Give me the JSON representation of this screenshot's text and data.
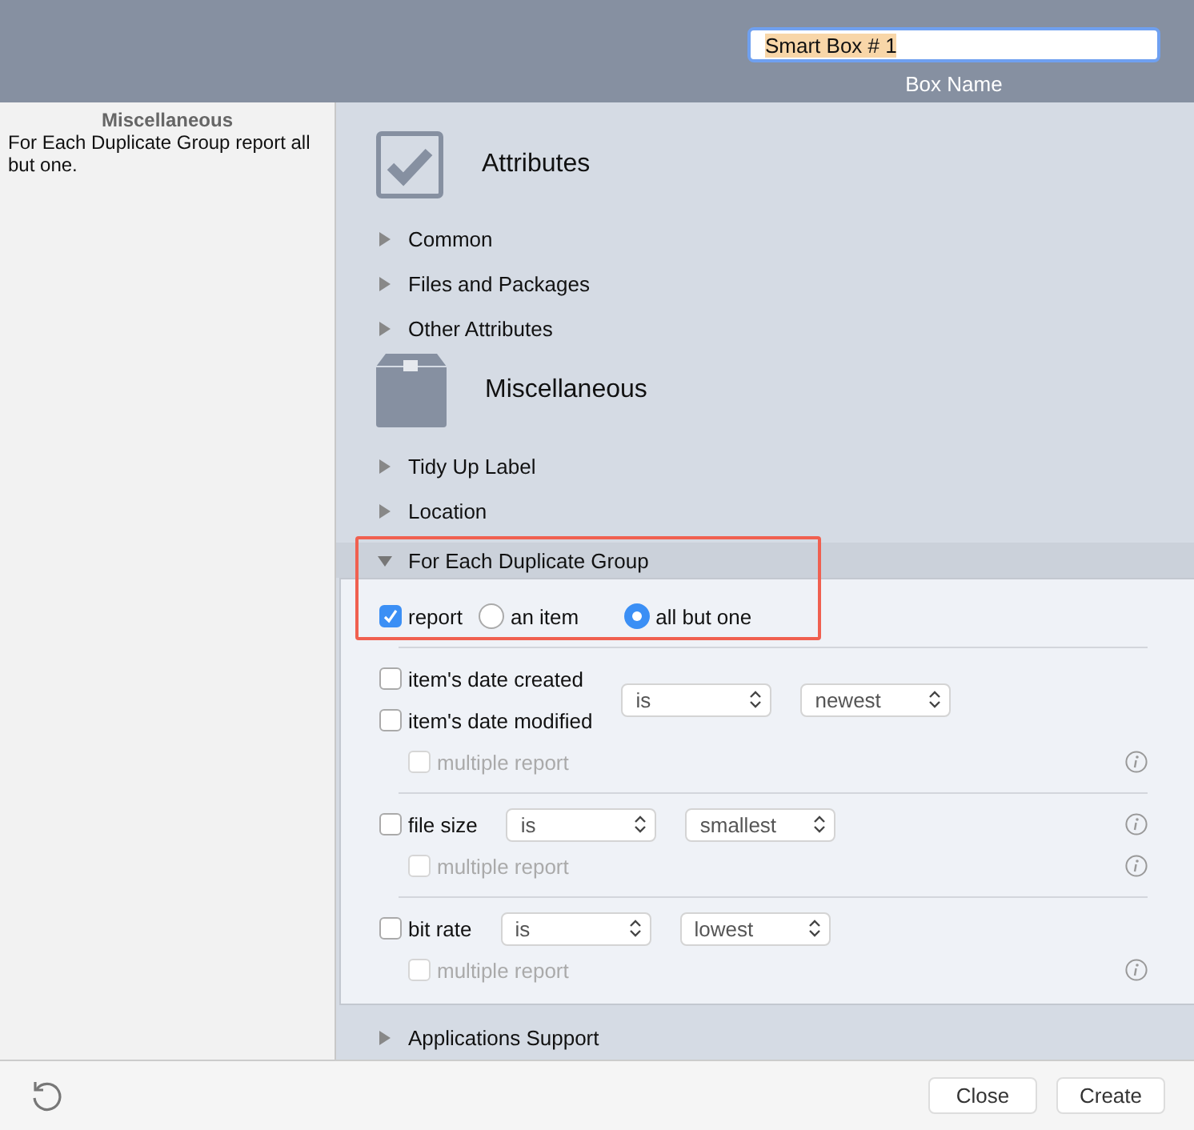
{
  "box_name": {
    "value": "Smart Box # 1",
    "label": "Box Name"
  },
  "summary": {
    "title": "Miscellaneous",
    "text": "For Each Duplicate Group report all but one."
  },
  "sections": [
    {
      "title": "Attributes",
      "items": [
        {
          "label": "Common",
          "expanded": false
        },
        {
          "label": "Files and Packages",
          "expanded": false
        },
        {
          "label": "Other Attributes",
          "expanded": false
        }
      ]
    },
    {
      "title": "Miscellaneous",
      "items": [
        {
          "label": "Tidy Up Label",
          "expanded": false
        },
        {
          "label": "Location",
          "expanded": false
        },
        {
          "label": "For Each Duplicate Group",
          "expanded": true
        }
      ]
    }
  ],
  "duplicate_group": {
    "report": {
      "label": "report",
      "checked": true
    },
    "options": [
      {
        "label": "an item",
        "selected": false
      },
      {
        "label": "all but one",
        "selected": true
      }
    ],
    "groups": [
      {
        "criteria": [
          {
            "label": "item's date created",
            "checked": false
          },
          {
            "label": "item's date modified",
            "checked": false
          }
        ],
        "operator": "is",
        "value": "newest",
        "info": false,
        "multiple": {
          "label": "multiple report",
          "checked": false,
          "disabled": true
        }
      },
      {
        "criteria": [
          {
            "label": "file size",
            "checked": false
          }
        ],
        "operator": "is",
        "value": "smallest",
        "info": true,
        "multiple": {
          "label": "multiple report",
          "checked": false,
          "disabled": true
        }
      },
      {
        "criteria": [
          {
            "label": "bit rate",
            "checked": false
          }
        ],
        "operator": "is",
        "value": "lowest",
        "info": false,
        "multiple": {
          "label": "multiple report",
          "checked": false,
          "disabled": true
        }
      }
    ]
  },
  "after": [
    {
      "label": "Applications Support",
      "expanded": false
    }
  ],
  "buttons": [
    "Close",
    "Create"
  ]
}
